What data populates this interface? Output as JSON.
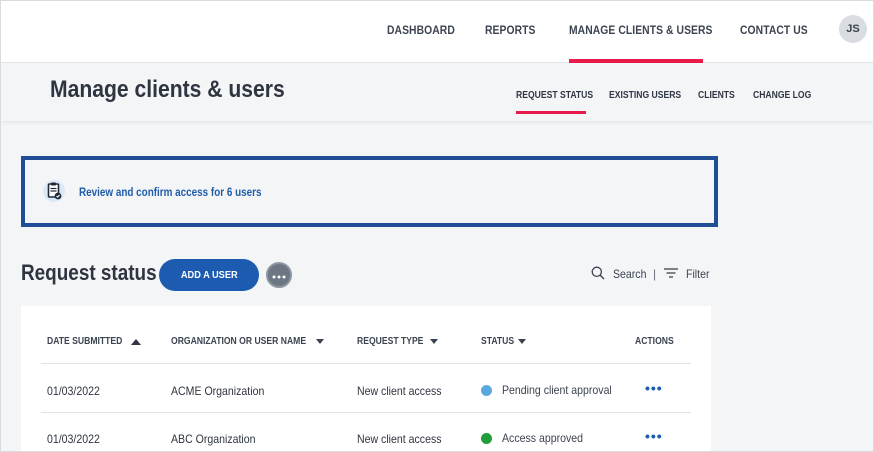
{
  "topnav": {
    "items": [
      "DASHBOARD",
      "REPORTS",
      "MANAGE CLIENTS & USERS",
      "CONTACT US"
    ],
    "active_index": 2,
    "avatar_initials": "JS"
  },
  "page": {
    "title": "Manage clients & users",
    "subtabs": [
      "REQUEST STATUS",
      "EXISTING USERS",
      "CLIENTS",
      "CHANGE LOG"
    ],
    "active_subtab_index": 0
  },
  "banner": {
    "icon": "clipboard-check-icon",
    "text": "Review and confirm access for 6 users"
  },
  "request_section": {
    "title": "Request status",
    "add_button": "ADD A USER",
    "more_icon": "more-horizontal-icon",
    "search_label": "Search",
    "filter_label": "Filter"
  },
  "table": {
    "columns": [
      {
        "label": "DATE SUBMITTED",
        "sort": "asc"
      },
      {
        "label": "ORGANIZATION OR USER NAME",
        "sort": "desc"
      },
      {
        "label": "REQUEST TYPE",
        "sort": "desc"
      },
      {
        "label": "STATUS",
        "sort": "desc"
      },
      {
        "label": "ACTIONS",
        "sort": "none"
      }
    ],
    "rows": [
      {
        "date": "01/03/2022",
        "name": "ACME Organization",
        "type": "New client access",
        "status": "Pending client approval",
        "status_color": "#5aa9dc",
        "actions": "•••"
      },
      {
        "date": "01/03/2022",
        "name": "ABC Organization",
        "type": "New client access",
        "status": "Access approved",
        "status_color": "#1f9e3a",
        "actions": "•••"
      }
    ]
  },
  "colors": {
    "accent_pink": "#e8194b",
    "primary_blue": "#1c5bb0",
    "banner_border": "#1f4e96"
  }
}
